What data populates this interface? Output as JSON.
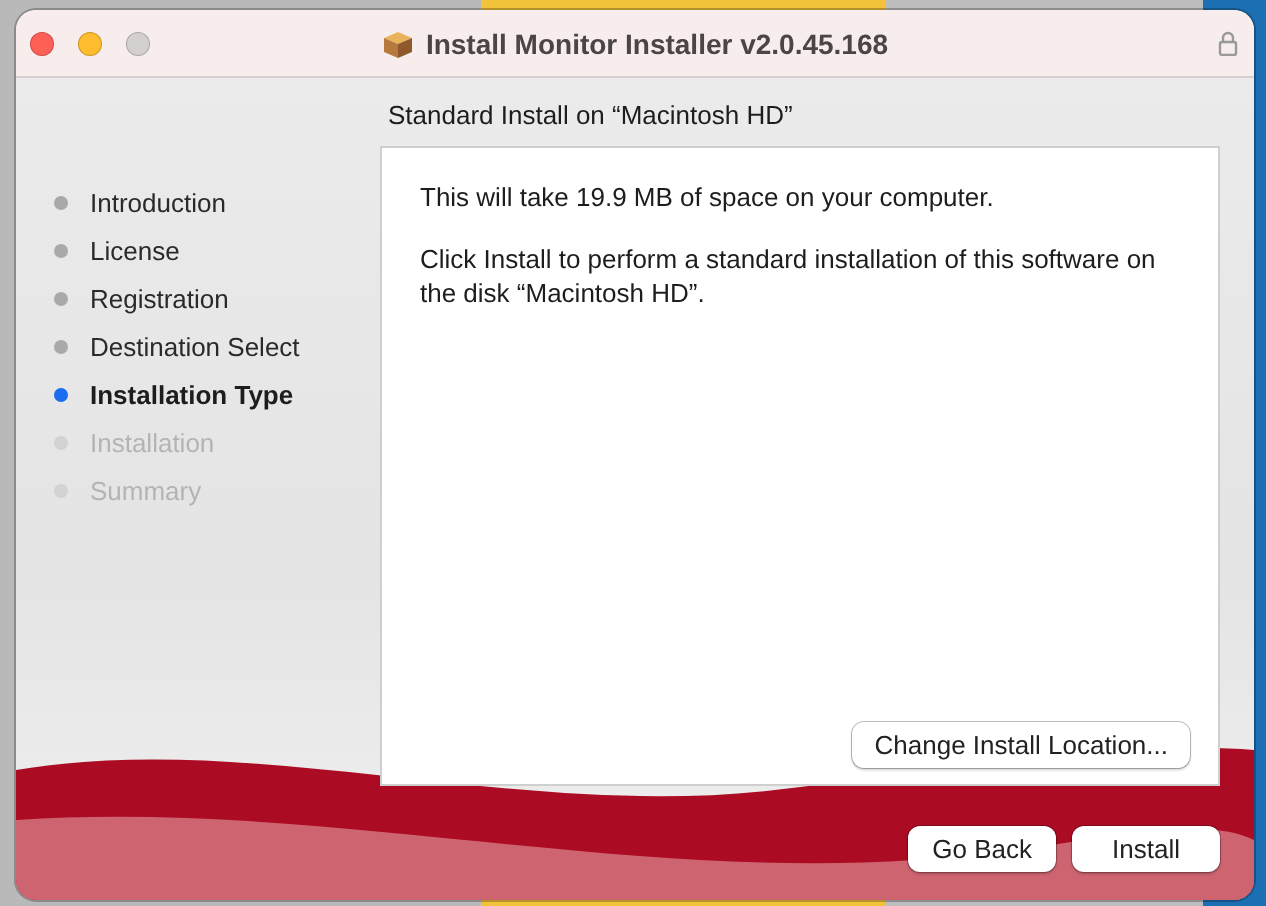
{
  "window": {
    "title": "Install Monitor Installer v2.0.45.168"
  },
  "heading": "Standard Install on “Macintosh HD”",
  "steps": [
    {
      "label": "Introduction",
      "visited": true,
      "selected": false
    },
    {
      "label": "License",
      "visited": true,
      "selected": false
    },
    {
      "label": "Registration",
      "visited": true,
      "selected": false
    },
    {
      "label": "Destination Select",
      "visited": true,
      "selected": false
    },
    {
      "label": "Installation Type",
      "visited": true,
      "selected": true
    },
    {
      "label": "Installation",
      "visited": false,
      "selected": false
    },
    {
      "label": "Summary",
      "visited": false,
      "selected": false
    }
  ],
  "panel": {
    "paragraphs": [
      "This will take 19.9 MB of space on your computer.",
      "Click Install to perform a standard installation of this software on the disk “Macintosh HD”."
    ],
    "location_button": "Change Install Location..."
  },
  "buttons": [
    "Go Back",
    "Install"
  ]
}
